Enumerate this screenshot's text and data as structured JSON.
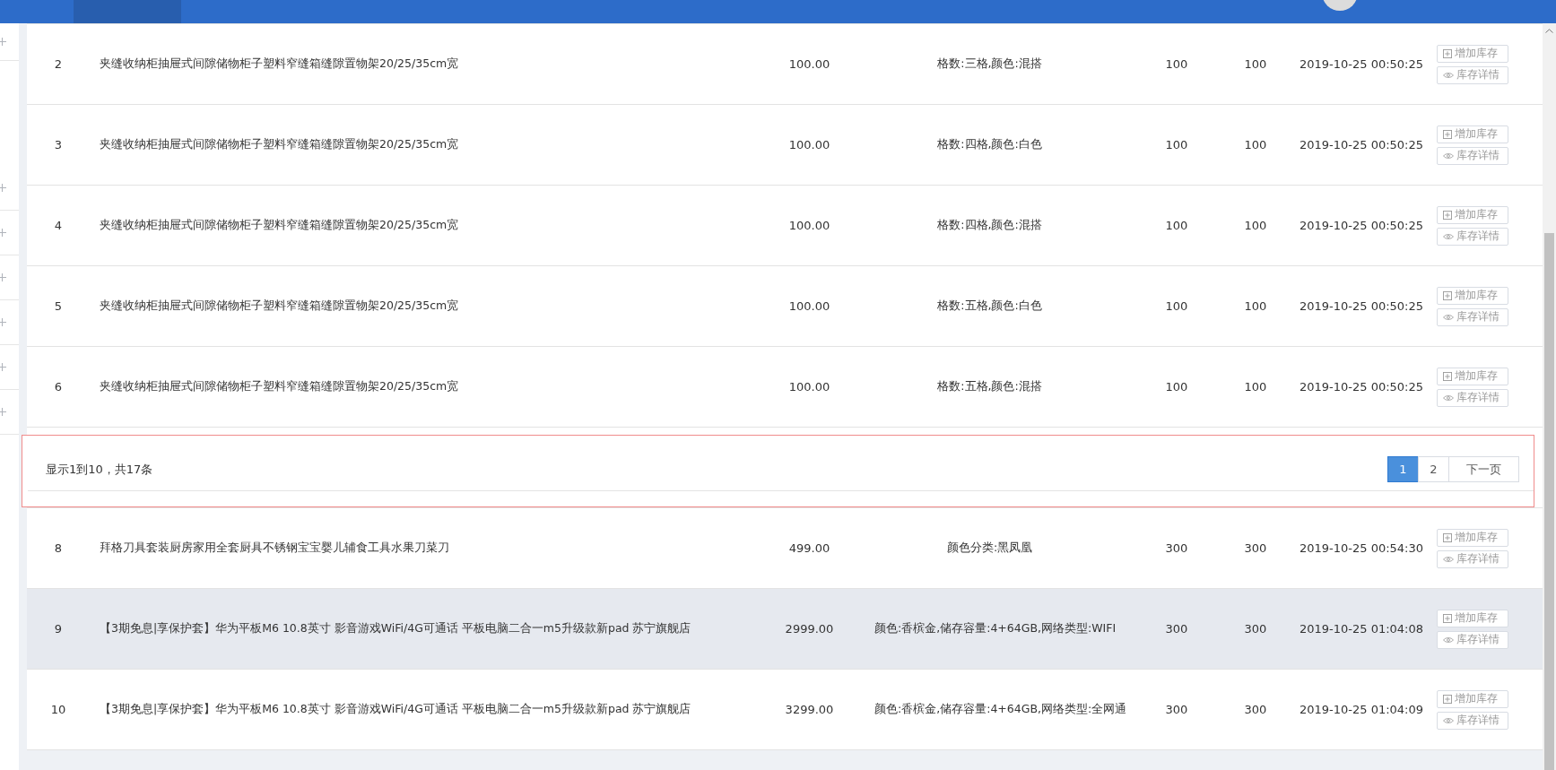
{
  "rows": [
    {
      "index": "2",
      "name": "夹缝收纳柜抽屉式间隙储物柜子塑料窄缝箱缝隙置物架20/25/35cm宽",
      "price": "100.00",
      "spec": "格数:三格,颜色:混搭",
      "qty_1": "100",
      "qty_2": "100",
      "time": "2019-10-25 00:50:25",
      "actions": [
        "增加库存",
        "库存详情"
      ],
      "highlighted": false
    },
    {
      "index": "3",
      "name": "夹缝收纳柜抽屉式间隙储物柜子塑料窄缝箱缝隙置物架20/25/35cm宽",
      "price": "100.00",
      "spec": "格数:四格,颜色:白色",
      "qty_1": "100",
      "qty_2": "100",
      "time": "2019-10-25 00:50:25",
      "actions": [
        "增加库存",
        "库存详情"
      ],
      "highlighted": false
    },
    {
      "index": "4",
      "name": "夹缝收纳柜抽屉式间隙储物柜子塑料窄缝箱缝隙置物架20/25/35cm宽",
      "price": "100.00",
      "spec": "格数:四格,颜色:混搭",
      "qty_1": "100",
      "qty_2": "100",
      "time": "2019-10-25 00:50:25",
      "actions": [
        "增加库存",
        "库存详情"
      ],
      "highlighted": false
    },
    {
      "index": "5",
      "name": "夹缝收纳柜抽屉式间隙储物柜子塑料窄缝箱缝隙置物架20/25/35cm宽",
      "price": "100.00",
      "spec": "格数:五格,颜色:白色",
      "qty_1": "100",
      "qty_2": "100",
      "time": "2019-10-25 00:50:25",
      "actions": [
        "增加库存",
        "库存详情"
      ],
      "highlighted": false
    },
    {
      "index": "6",
      "name": "夹缝收纳柜抽屉式间隙储物柜子塑料窄缝箱缝隙置物架20/25/35cm宽",
      "price": "100.00",
      "spec": "格数:五格,颜色:混搭",
      "qty_1": "100",
      "qty_2": "100",
      "time": "2019-10-25 00:50:25",
      "actions": [
        "增加库存",
        "库存详情"
      ],
      "highlighted": false
    },
    {
      "kind": "pager"
    },
    {
      "index": "8",
      "name": "拜格刀具套装厨房家用全套厨具不锈钢宝宝婴儿辅食工具水果刀菜刀",
      "price": "499.00",
      "spec": "颜色分类:黑凤凰",
      "qty_1": "300",
      "qty_2": "300",
      "time": "2019-10-25 00:54:30",
      "actions": [
        "增加库存",
        "库存详情"
      ],
      "highlighted": false
    },
    {
      "index": "9",
      "name": "【3期免息|享保护套】华为平板M6 10.8英寸 影音游戏WiFi/4G可通话 平板电脑二合一m5升级款新pad 苏宁旗舰店",
      "price": "2999.00",
      "spec": "颜色:香槟金,储存容量:4+64GB,网络类型:WIFI",
      "qty_1": "300",
      "qty_2": "300",
      "time": "2019-10-25 01:04:08",
      "actions": [
        "增加库存",
        "库存详情"
      ],
      "highlighted": true
    },
    {
      "index": "10",
      "name": "【3期免息|享保护套】华为平板M6 10.8英寸 影音游戏WiFi/4G可通话 平板电脑二合一m5升级款新pad 苏宁旗舰店",
      "price": "3299.00",
      "spec": "颜色:香槟金,储存容量:4+64GB,网络类型:全网通",
      "qty_1": "300",
      "qty_2": "300",
      "time": "2019-10-25 01:04:09",
      "actions": [
        "增加库存",
        "库存详情"
      ],
      "highlighted": false
    }
  ],
  "pagination": {
    "summary": "显示1到10，共17条",
    "pages": [
      {
        "label": "1",
        "selected": true
      },
      {
        "label": "2",
        "selected": false
      }
    ],
    "next": "下一页"
  }
}
